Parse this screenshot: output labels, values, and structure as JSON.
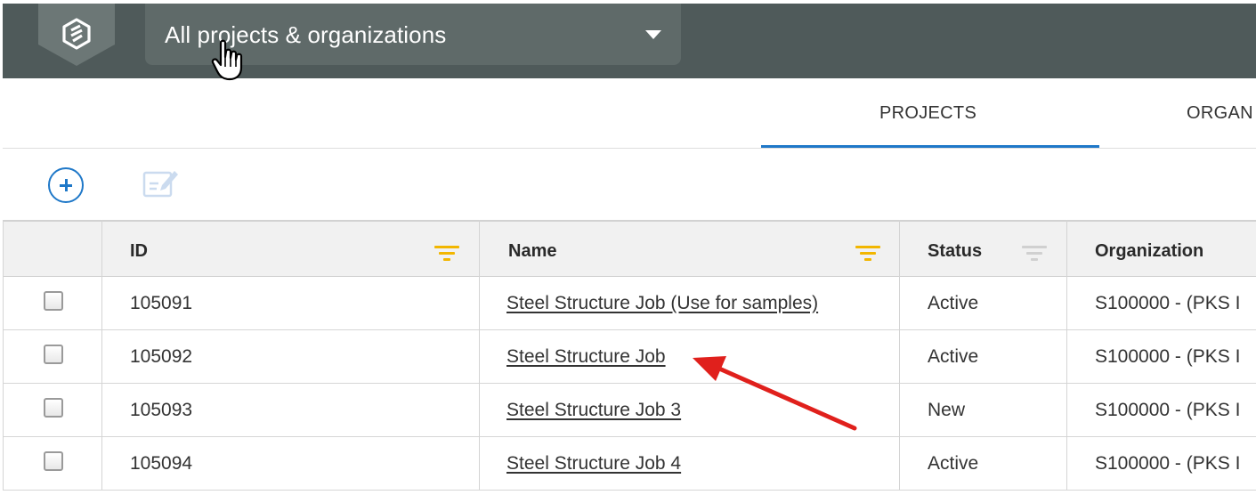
{
  "header": {
    "scope_selector_label": "All projects & organizations"
  },
  "tabs": [
    {
      "label": "PROJECTS",
      "active": true
    },
    {
      "label": "ORGAN"
    }
  ],
  "table": {
    "columns": [
      {
        "label": "ID",
        "filter_active": true
      },
      {
        "label": "Name",
        "filter_active": true
      },
      {
        "label": "Status",
        "filter_active": false
      },
      {
        "label": "Organization"
      }
    ],
    "rows": [
      {
        "id": "105091",
        "name": "Steel Structure Job (Use for samples)",
        "status": "Active",
        "organization": "S100000 - (PKS I"
      },
      {
        "id": "105092",
        "name": "Steel Structure Job",
        "status": "Active",
        "organization": "S100000 - (PKS I"
      },
      {
        "id": "105093",
        "name": "Steel Structure Job 3",
        "status": "New",
        "organization": "S100000 - (PKS I"
      },
      {
        "id": "105094",
        "name": "Steel Structure Job 4",
        "status": "Active",
        "organization": "S100000 - (PKS I"
      }
    ]
  },
  "colors": {
    "topbar": "#4f5a5a",
    "dropdown": "#5f6a69",
    "accent_blue": "#1f78c8",
    "filter_active": "#f2b600",
    "filter_inactive": "#d0d0d0",
    "annotation_arrow": "#e0201c"
  },
  "icons": {
    "logo": "logo-shield-icon",
    "dropdown": "caret-down-icon",
    "cursor": "hand-pointer-cursor-icon",
    "add": "add-circle-icon",
    "edit": "edit-note-icon",
    "filter": "filter-icon"
  }
}
